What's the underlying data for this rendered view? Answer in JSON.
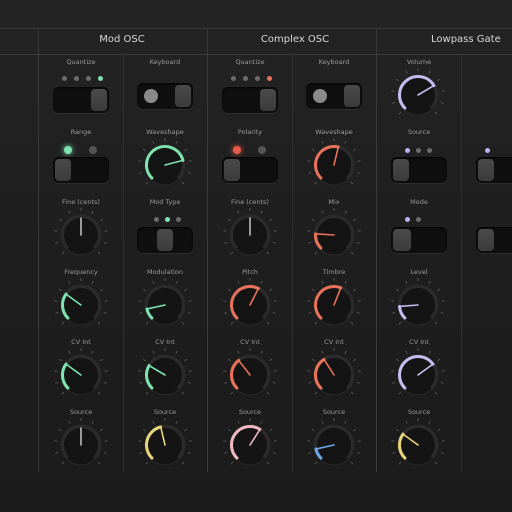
{
  "sections": {
    "mod_osc": {
      "title": "Mod OSC"
    },
    "complex_osc": {
      "title": "Complex OSC"
    },
    "lowpass_gate": {
      "title": "Lowpass Gate"
    }
  },
  "labels": {
    "quantize": "Quantize",
    "keyboard": "Keyboard",
    "range": "Range",
    "waveshape": "Waveshape",
    "polarity": "Polarity",
    "fine": "Fine (cents)",
    "mod_type": "Mod Type",
    "mix": "Mix",
    "frequency": "Frequency",
    "modulation": "Modulation",
    "pitch": "Pitch",
    "timbre": "Timbre",
    "cv_int": "CV Int",
    "source": "Source",
    "volume": "Volume",
    "mode": "Mode",
    "level": "Level"
  },
  "colors": {
    "green": "#7fe3b0",
    "red": "#e8735a",
    "lavender": "#c4bdf0",
    "yellow": "#e8d67a",
    "pink": "#efb9c2",
    "blue": "#6aa8e8",
    "neutral": "#bdbdbd",
    "led_green": "#7fe3b0",
    "led_red": "#e85a4a",
    "led_blue": "#b9b6f0"
  },
  "knobs": [
    {
      "id": "mod-fine-knob",
      "value": 0.5,
      "color": "neutral"
    },
    {
      "id": "mod-waveshape-knob",
      "value": 0.78,
      "color": "green"
    },
    {
      "id": "complex-fine-knob",
      "value": 0.5,
      "color": "neutral"
    },
    {
      "id": "complex-waveshape-knob",
      "value": 0.55,
      "color": "red"
    },
    {
      "id": "complex-mix-knob",
      "value": 0.18,
      "color": "red"
    },
    {
      "id": "lpg-volume-knob",
      "value": 0.72,
      "color": "lavender"
    },
    {
      "id": "mod-frequency-knob",
      "value": 0.3,
      "color": "green"
    },
    {
      "id": "mod-modulation-knob",
      "value": 0.12,
      "color": "green"
    },
    {
      "id": "complex-pitch-knob",
      "value": 0.6,
      "color": "red"
    },
    {
      "id": "complex-timbre-knob",
      "value": 0.58,
      "color": "red"
    },
    {
      "id": "lpg-level-knob",
      "value": 0.15,
      "color": "lavender"
    },
    {
      "id": "mod-cv-int-knob",
      "value": 0.3,
      "color": "green"
    },
    {
      "id": "mod-cv2-int-knob",
      "value": 0.28,
      "color": "green"
    },
    {
      "id": "complex-cv-int-knob",
      "value": 0.36,
      "color": "red"
    },
    {
      "id": "complex-cv2-int-knob",
      "value": 0.38,
      "color": "red"
    },
    {
      "id": "lpg-cv-int-knob",
      "value": 0.7,
      "color": "lavender"
    },
    {
      "id": "mod-source-knob",
      "value": 0.5,
      "color": "neutral"
    },
    {
      "id": "mod-source2-knob",
      "value": 0.45,
      "color": "yellow"
    },
    {
      "id": "complex-source-knob",
      "value": 0.62,
      "color": "pink"
    },
    {
      "id": "complex-source2-knob",
      "value": 0.12,
      "color": "blue"
    },
    {
      "id": "lpg-source-knob",
      "value": 0.3,
      "color": "yellow"
    }
  ]
}
